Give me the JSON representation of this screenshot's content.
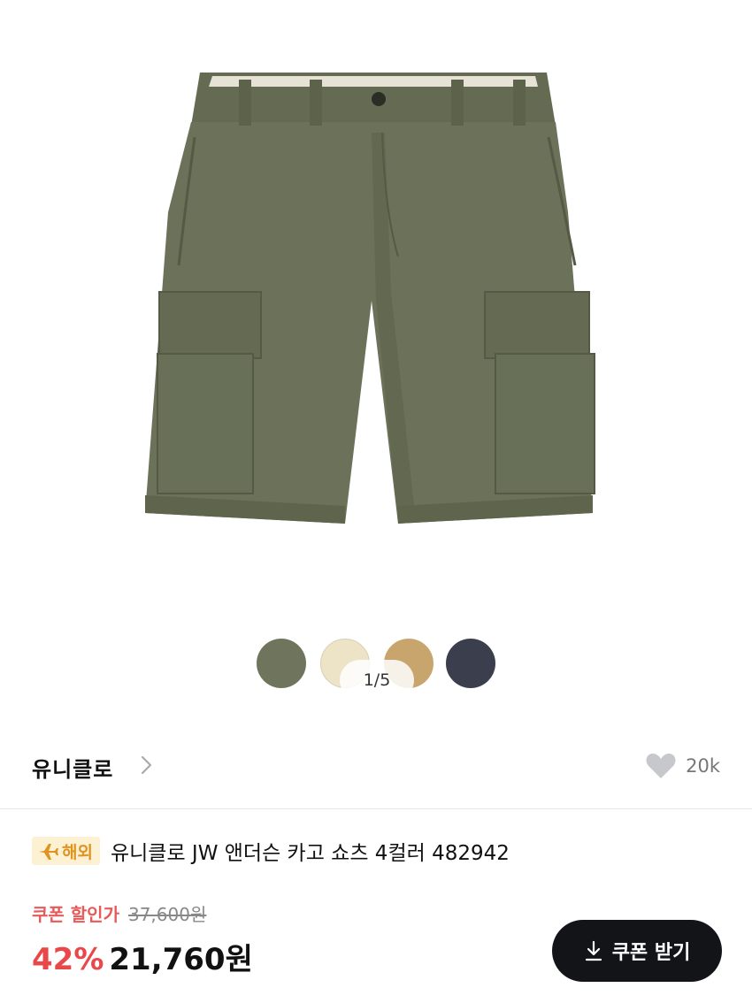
{
  "gallery": {
    "product_image": "olive-cargo-shorts",
    "page_indicator": "1/5",
    "swatches": [
      {
        "name": "olive",
        "color": "#6f755c"
      },
      {
        "name": "cream",
        "color": "#ede3c6"
      },
      {
        "name": "beige",
        "color": "#c9a56e"
      },
      {
        "name": "navy",
        "color": "#3b3e4c"
      }
    ]
  },
  "brand": {
    "name": "유니클로",
    "icon": "chevron-right-icon"
  },
  "likes": {
    "icon": "heart-icon",
    "count": "20k"
  },
  "product": {
    "badge_label": "해외",
    "badge_icon": "airplane-icon",
    "title": "유니클로 JW 앤더슨 카고 쇼츠 4컬러 482942"
  },
  "price": {
    "coupon_label": "쿠폰 할인가",
    "original": "37,600원",
    "discount_rate": "42%",
    "final": "21,760원"
  },
  "coupon_button": {
    "label": "쿠폰 받기",
    "icon": "download-icon"
  },
  "colors": {
    "accent_red": "#e9484b",
    "badge_bg": "#fdf1d3",
    "badge_text": "#e0941f",
    "button_bg": "#121418"
  }
}
